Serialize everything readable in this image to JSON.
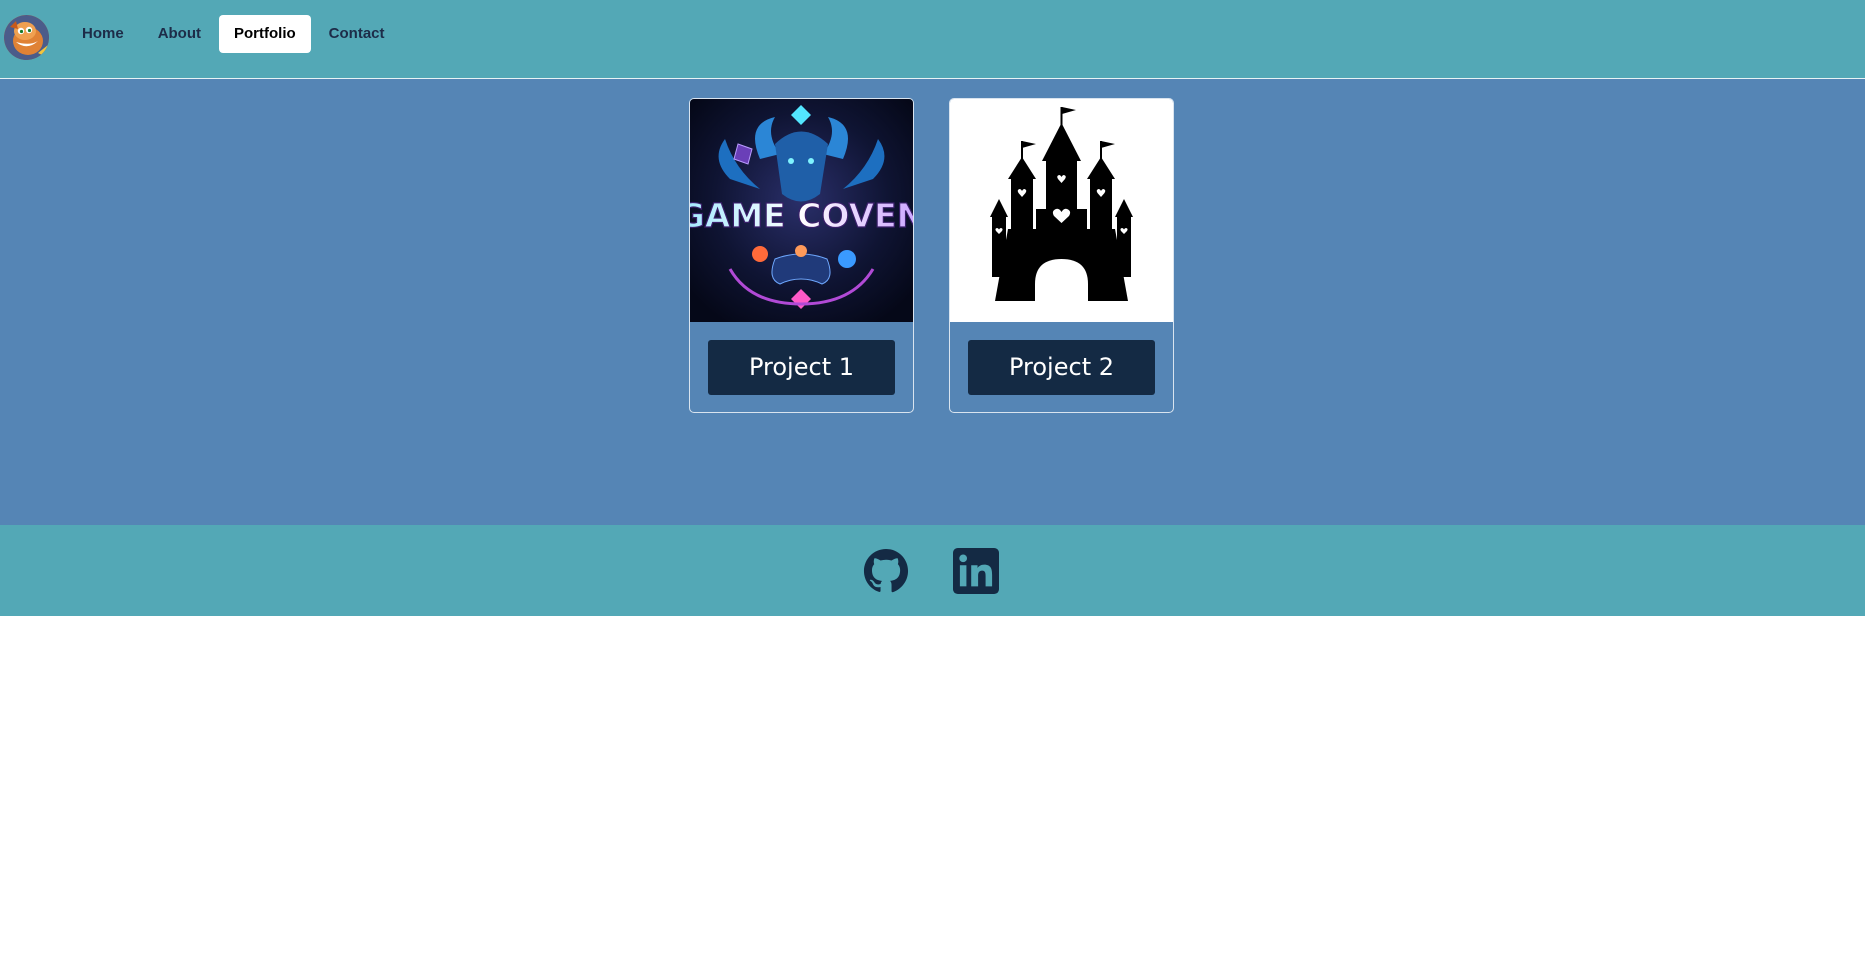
{
  "nav": {
    "items": [
      {
        "label": "Home"
      },
      {
        "label": "About"
      },
      {
        "label": "Portfolio",
        "active": true
      },
      {
        "label": "Contact"
      }
    ]
  },
  "projects": [
    {
      "label": "Project 1",
      "image_text": "GAME COVEN"
    },
    {
      "label": "Project 2"
    }
  ],
  "footer": {
    "links": [
      {
        "icon": "github-icon"
      },
      {
        "icon": "linkedin-icon"
      }
    ]
  },
  "colors": {
    "header_bg": "#53a8b6",
    "main_bg": "#5585b5",
    "button_bg": "#142a44",
    "nav_text": "#1d2c48"
  }
}
